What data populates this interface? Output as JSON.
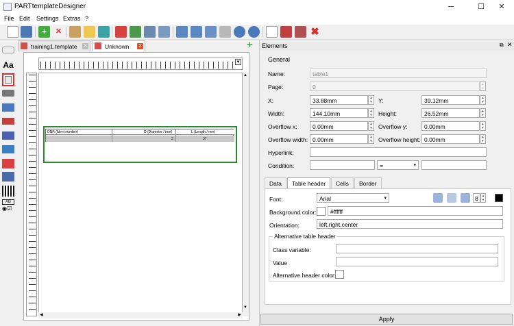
{
  "window": {
    "title": "PARTtemplateDesigner",
    "minimize": "─",
    "maximize": "☐",
    "close": "✕"
  },
  "menu": [
    "File",
    "Edit",
    "Settings",
    "Extras",
    "?"
  ],
  "tabs": [
    {
      "label": "training1.template",
      "close": "✕"
    },
    {
      "label": "Unknown",
      "close": "✕"
    }
  ],
  "add_tab": "+",
  "canvas_table": {
    "headers": [
      "DNR (Ident number)",
      "D (Diameter / mm)",
      "L (Length / mm)"
    ],
    "row": [
      "",
      "3",
      "37"
    ]
  },
  "elements_panel": {
    "title": "Elements",
    "section": "General",
    "name_label": "Name:",
    "name_value": "table1",
    "page_label": "Page:",
    "page_value": "0",
    "x_label": "X:",
    "x_value": "33.88mm",
    "y_label": "Y:",
    "y_value": "39.12mm",
    "width_label": "Width:",
    "width_value": "144.10mm",
    "height_label": "Height:",
    "height_value": "26.52mm",
    "overflow_x_label": "Overflow x:",
    "overflow_x_value": "0.00mm",
    "overflow_y_label": "Overflow y:",
    "overflow_y_value": "0.00mm",
    "overflow_width_label": "Overflow width:",
    "overflow_width_value": "0.00mm",
    "overflow_height_label": "Overflow height:",
    "overflow_height_value": "0.00mm",
    "hyperlink_label": "Hyperlink:",
    "hyperlink_value": "",
    "condition_label": "Condition:",
    "condition_value": "",
    "condition_operator": "=",
    "condition_operand": ""
  },
  "subtabs": [
    "Data",
    "Table header",
    "Cells",
    "Border"
  ],
  "table_header": {
    "font_label": "Font:",
    "font_value": "Arial",
    "font_size": "8",
    "bg_label": "Background color:",
    "bg_value": "#ffffff",
    "orientation_label": "Orientation:",
    "orientation_value": "left,right,center",
    "alt_group": "Alternative table header",
    "class_var_label": "Class variable:",
    "class_var_value": "",
    "value_label": "Value",
    "value_value": "",
    "alt_color_label": "Alternative header color:"
  },
  "apply_label": "Apply",
  "colors": {
    "selection": "#2b8a2b",
    "accent": "#d9302c"
  }
}
